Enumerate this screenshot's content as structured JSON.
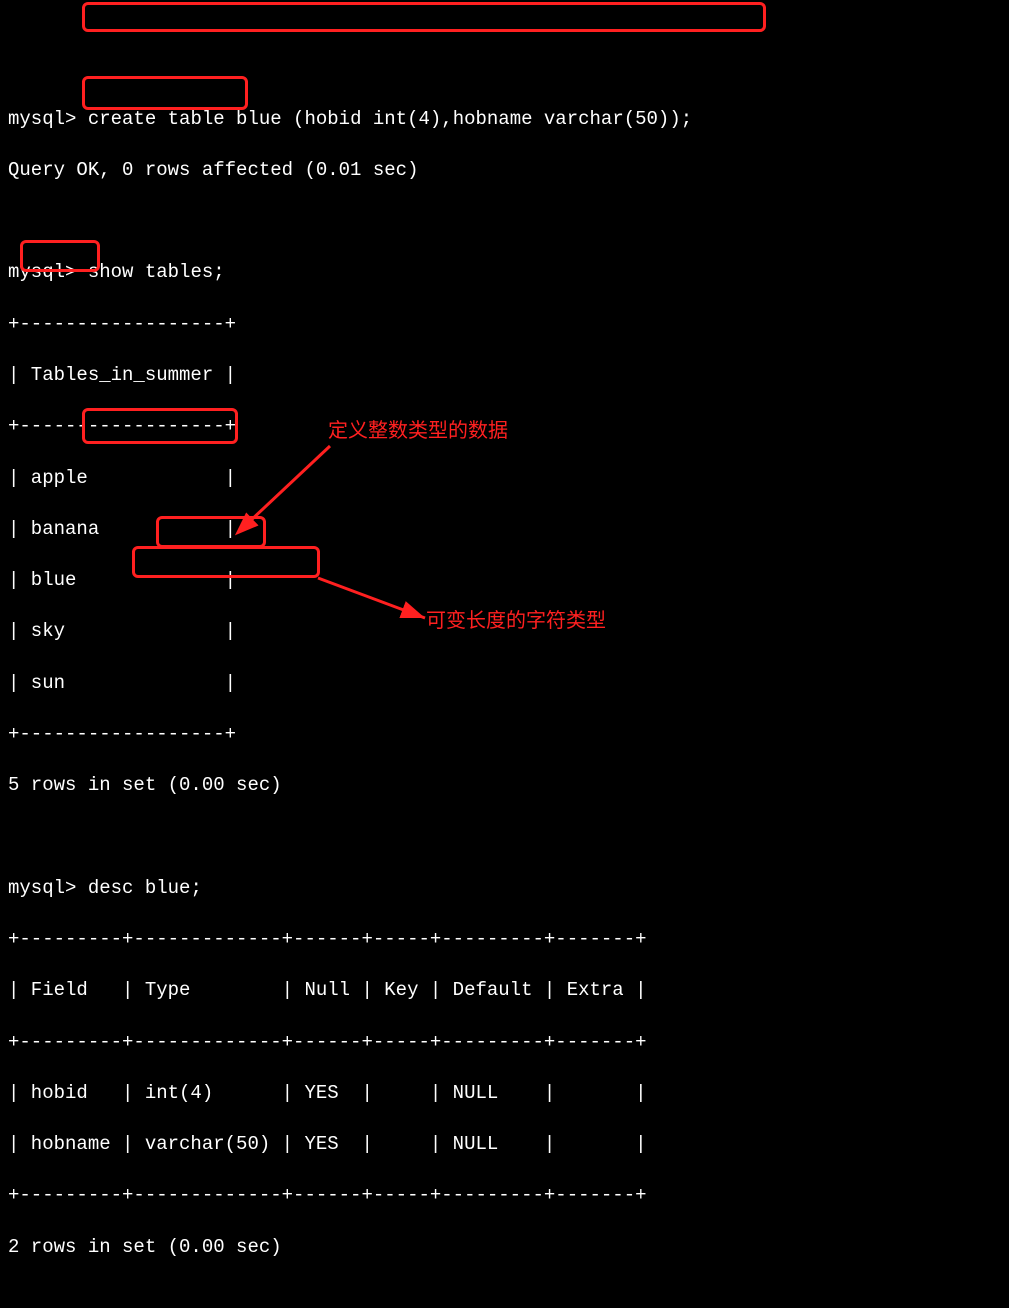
{
  "prompt": "mysql> ",
  "cmd1": "create table blue (hobid int(4),hobname varchar(50));",
  "resp1": "Query OK, 0 rows affected (0.01 sec)",
  "cmd2": "show tables;",
  "tables_border": "+------------------+",
  "tables_header": "| Tables_in_summer |",
  "tables_rows": [
    "| apple            |",
    "| banana           |",
    "| blue             |",
    "| sky              |",
    "| sun              |"
  ],
  "tables_footer": "5 rows in set (0.00 sec)",
  "cmd3": "desc blue;",
  "desc_border": "+---------+-------------+------+-----+---------+-------+",
  "desc_header": "| Field   | Type        | Null | Key | Default | Extra |",
  "desc_rows": [
    "| hobid   | int(4)      | YES  |     | NULL    |       |",
    "| hobname | varchar(50) | YES  |     | NULL    |       |"
  ],
  "desc_footer": "2 rows in set (0.00 sec)",
  "anno1": "定义整数类型的数据",
  "anno2": "可变长度的字符类型",
  "highlight_color": "#ff2020"
}
